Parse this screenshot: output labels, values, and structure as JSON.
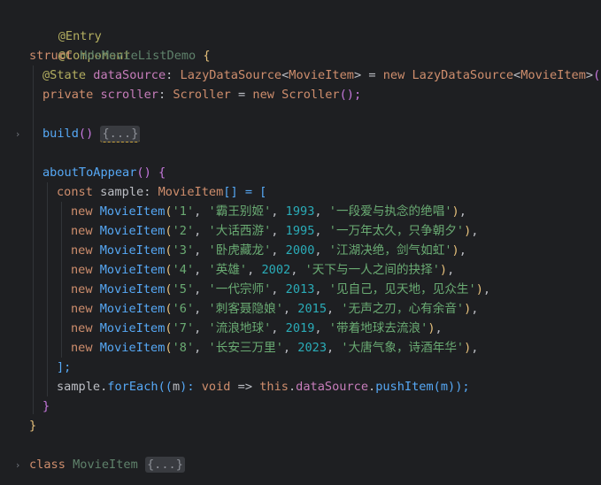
{
  "code": {
    "l1": {
      "a": "@Entry"
    },
    "l2": {
      "a": "@Component"
    },
    "l3": {
      "kw": "struct",
      "name": "HdsMovieListDemo",
      "brace": " {"
    },
    "l4": {
      "ann": "@State",
      "field": "dataSource",
      "colon": ": ",
      "type1": "LazyDataSource",
      "lt1": "<",
      "gen1": "MovieItem",
      "gt1": ">",
      "eq": " = ",
      "kwnew": "new",
      "type2": " LazyDataSource",
      "lt2": "<",
      "gen2": "MovieItem",
      "gt2": ">",
      "call": "();"
    },
    "l5": {
      "kw": "private",
      "field": "scroller",
      "colon": ": ",
      "type1": "Scroller",
      "eq": " = ",
      "kwnew": "new",
      "type2": " Scroller",
      "call": "();"
    },
    "l7": {
      "fn": "build",
      "paren": "()",
      "collapsed": "{...}"
    },
    "l9": {
      "fn": "aboutToAppear",
      "rest": "() {"
    },
    "l10": {
      "kw": "const",
      "name": " sample",
      "colon": ": ",
      "type": "MovieItem",
      "rest": "[] = ["
    },
    "rows": [
      {
        "new": "new",
        "cls": "MovieItem",
        "id": "'1'",
        "title": "'霸王别姬'",
        "year": "1993",
        "desc": "'一段爱与执念的绝唱'"
      },
      {
        "new": "new",
        "cls": "MovieItem",
        "id": "'2'",
        "title": "'大话西游'",
        "year": "1995",
        "desc": "'一万年太久，只争朝夕'"
      },
      {
        "new": "new",
        "cls": "MovieItem",
        "id": "'3'",
        "title": "'卧虎藏龙'",
        "year": "2000",
        "desc": "'江湖决绝，剑气如虹'"
      },
      {
        "new": "new",
        "cls": "MovieItem",
        "id": "'4'",
        "title": "'英雄'",
        "year": "2002",
        "desc": "'天下与一人之间的抉择'"
      },
      {
        "new": "new",
        "cls": "MovieItem",
        "id": "'5'",
        "title": "'一代宗师'",
        "year": "2013",
        "desc": "'见自己，见天地，见众生'"
      },
      {
        "new": "new",
        "cls": "MovieItem",
        "id": "'6'",
        "title": "'刺客聂隐娘'",
        "year": "2015",
        "desc": "'无声之刃，心有余音'"
      },
      {
        "new": "new",
        "cls": "MovieItem",
        "id": "'7'",
        "title": "'流浪地球'",
        "year": "2019",
        "desc": "'带着地球去流浪'"
      },
      {
        "new": "new",
        "cls": "MovieItem",
        "id": "'8'",
        "title": "'长安三万里'",
        "year": "2023",
        "desc": "'大唐气象，诗酒年华'"
      }
    ],
    "l19": {
      "a": "];"
    },
    "l20": {
      "obj": "sample",
      "dot": ".",
      "fn": "forEach",
      "p1": "((",
      "arg": "m",
      "rest1": "): ",
      "kwvoid": "void",
      "arrow": " => ",
      "kwthis": "this",
      "dot2": ".",
      "field": "dataSource",
      "dot3": ".",
      "fn2": "pushItem",
      "p2": "(m));"
    },
    "l21": {
      "a": "}"
    },
    "l22": {
      "a": "}"
    },
    "l24": {
      "kw": "class",
      "name": " MovieItem ",
      "collapsed": "{...}"
    }
  },
  "icons": {
    "fold_collapsed": "chevron-right-icon"
  }
}
